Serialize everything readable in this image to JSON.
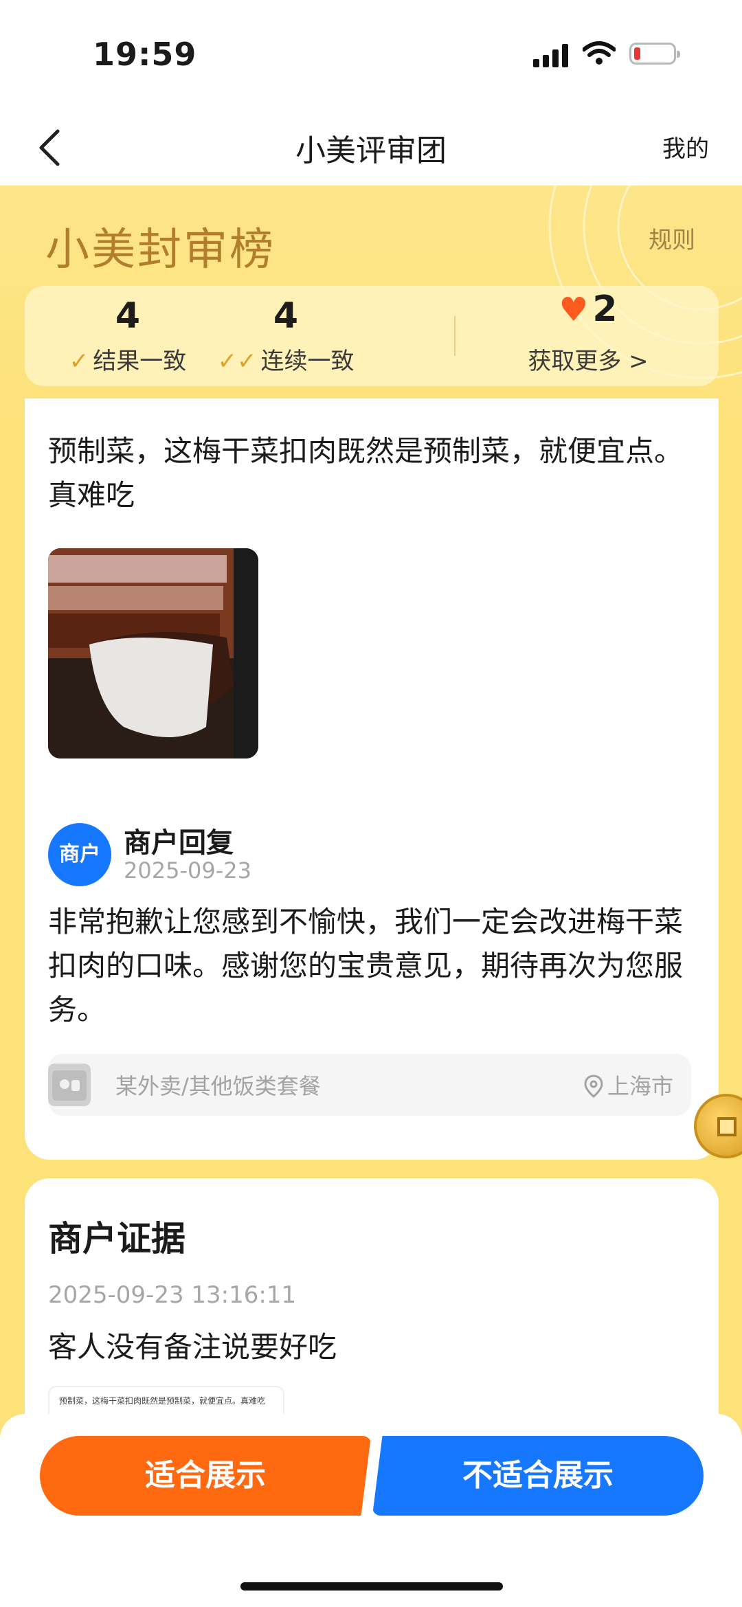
{
  "status_bar": {
    "time": "19:59"
  },
  "nav": {
    "title": "小美评审团",
    "mine": "我的"
  },
  "header": {
    "brand": "小美封审榜",
    "rules": "规则",
    "stats": [
      {
        "value": "4",
        "label": "结果一致"
      },
      {
        "value": "4",
        "label": "连续一致"
      },
      {
        "value": "2",
        "label": "获取更多 >"
      }
    ]
  },
  "review": {
    "text": "预制菜，这梅干菜扣肉既然是预制菜，就便宜点。真难吃",
    "reply_avatar": "商户",
    "reply_name": "商户回复",
    "reply_date": "2025-09-23",
    "reply_text": "非常抱歉让您感到不愉快，我们一定会改进梅干菜扣肉的口味。感谢您的宝贵意见，期待再次为您服务。",
    "store_name": "某外卖/其他饭类套餐",
    "location": "上海市"
  },
  "evidence": {
    "title": "商户证据",
    "time": "2025-09-23 13:16:11",
    "text": "客人没有备注说要好吃",
    "thumb_text": "预制菜，这梅干菜扣肉既然是预制菜，就便宜点。真难吃"
  },
  "actions": {
    "suitable": "适合展示",
    "unsuitable": "不适合展示"
  },
  "colors": {
    "accent_orange": "#ff6a10",
    "accent_blue": "#1677ff",
    "header_yellow": "#fde27a"
  }
}
